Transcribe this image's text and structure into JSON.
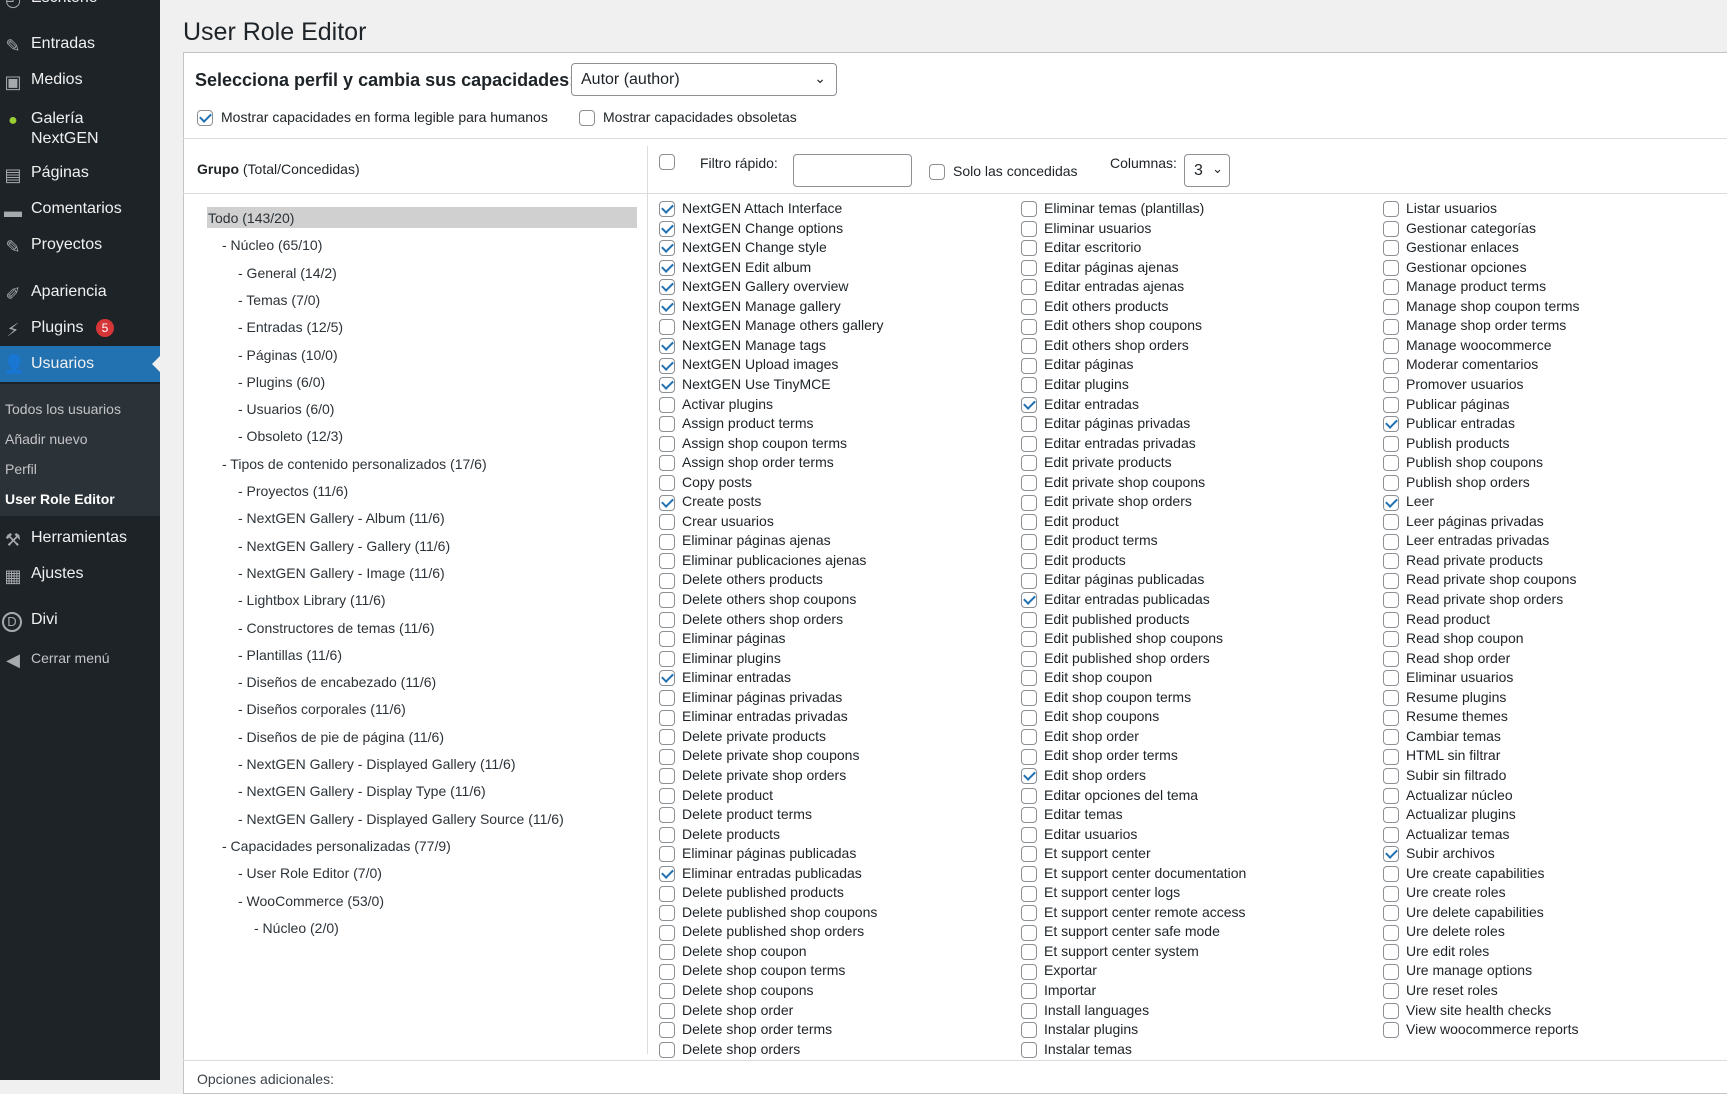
{
  "sidebar": {
    "items": [
      {
        "label": "Escritorio",
        "icon": "gauge-icon"
      },
      {
        "label": "Entradas",
        "icon": "pushpin-icon"
      },
      {
        "label": "Medios",
        "icon": "media-icon"
      },
      {
        "label": "Galería NextGEN",
        "icon": "nextgen-icon"
      },
      {
        "label": "Páginas",
        "icon": "page-icon"
      },
      {
        "label": "Comentarios",
        "icon": "comment-icon"
      },
      {
        "label": "Proyectos",
        "icon": "pushpin-icon"
      },
      {
        "label": "Apariencia",
        "icon": "brush-icon"
      },
      {
        "label": "Plugins",
        "icon": "plugin-icon",
        "badge": "5"
      },
      {
        "label": "Usuarios",
        "icon": "users-icon"
      },
      {
        "label": "Herramientas",
        "icon": "wrench-icon"
      },
      {
        "label": "Ajustes",
        "icon": "settings-icon"
      },
      {
        "label": "Divi",
        "icon": "divi-icon"
      },
      {
        "label": "Cerrar menú",
        "icon": "collapse-icon"
      }
    ],
    "users_submenu": [
      "Todos los usuarios",
      "Añadir nuevo",
      "Perfil",
      "User Role Editor"
    ],
    "accent": "#2271b1"
  },
  "page": {
    "title": "User Role Editor",
    "role_label": "Selecciona perfil y cambia sus capacidades:",
    "role_selected": "Autor (author)",
    "human_readable_label": "Mostrar capacidades en forma legible para humanos",
    "deprecated_label": "Mostrar capacidades obsoletas",
    "group_header_bold": "Grupo",
    "group_header_rest": " (Total/Concedidas)",
    "quick_filter_label": "Filtro rápido:",
    "quick_filter_value": "",
    "granted_only_label": "Solo las concedidas",
    "columns_label": "Columnas:",
    "columns_value": "3",
    "additional_options": "Opciones adicionales:"
  },
  "groups": [
    {
      "label": "Todo (143/20)",
      "level": 0
    },
    {
      "label": "- Núcleo (65/10)",
      "level": 1
    },
    {
      "label": "- General (14/2)",
      "level": 2
    },
    {
      "label": "- Temas (7/0)",
      "level": 2
    },
    {
      "label": "- Entradas (12/5)",
      "level": 2
    },
    {
      "label": "- Páginas (10/0)",
      "level": 2
    },
    {
      "label": "- Plugins (6/0)",
      "level": 2
    },
    {
      "label": "- Usuarios (6/0)",
      "level": 2
    },
    {
      "label": "- Obsoleto (12/3)",
      "level": 2
    },
    {
      "label": "- Tipos de contenido personalizados (17/6)",
      "level": 1
    },
    {
      "label": "- Proyectos (11/6)",
      "level": 2
    },
    {
      "label": "- NextGEN Gallery - Album (11/6)",
      "level": 2
    },
    {
      "label": "- NextGEN Gallery - Gallery (11/6)",
      "level": 2
    },
    {
      "label": "- NextGEN Gallery - Image (11/6)",
      "level": 2
    },
    {
      "label": "- Lightbox Library (11/6)",
      "level": 2
    },
    {
      "label": "- Constructores de temas (11/6)",
      "level": 2
    },
    {
      "label": "- Plantillas (11/6)",
      "level": 2
    },
    {
      "label": "- Diseños de encabezado (11/6)",
      "level": 2
    },
    {
      "label": "- Diseños corporales (11/6)",
      "level": 2
    },
    {
      "label": "- Diseños de pie de página (11/6)",
      "level": 2
    },
    {
      "label": "- NextGEN Gallery - Displayed Gallery (11/6)",
      "level": 2
    },
    {
      "label": "- NextGEN Gallery - Display Type (11/6)",
      "level": 2
    },
    {
      "label": "- NextGEN Gallery - Displayed Gallery Source (11/6)",
      "level": 2
    },
    {
      "label": "- Capacidades personalizadas (77/9)",
      "level": 1
    },
    {
      "label": "- User Role Editor (7/0)",
      "level": 2
    },
    {
      "label": "- WooCommerce (53/0)",
      "level": 2
    },
    {
      "label": "- Núcleo (2/0)",
      "level": 3
    }
  ],
  "capabilities": [
    [
      {
        "label": "NextGEN Attach Interface",
        "checked": true
      },
      {
        "label": "NextGEN Change options",
        "checked": true
      },
      {
        "label": "NextGEN Change style",
        "checked": true
      },
      {
        "label": "NextGEN Edit album",
        "checked": true
      },
      {
        "label": "NextGEN Gallery overview",
        "checked": true
      },
      {
        "label": "NextGEN Manage gallery",
        "checked": true
      },
      {
        "label": "NextGEN Manage others gallery",
        "checked": false
      },
      {
        "label": "NextGEN Manage tags",
        "checked": true
      },
      {
        "label": "NextGEN Upload images",
        "checked": true
      },
      {
        "label": "NextGEN Use TinyMCE",
        "checked": true
      },
      {
        "label": "Activar plugins",
        "checked": false
      },
      {
        "label": "Assign product terms",
        "checked": false
      },
      {
        "label": "Assign shop coupon terms",
        "checked": false
      },
      {
        "label": "Assign shop order terms",
        "checked": false
      },
      {
        "label": "Copy posts",
        "checked": false
      },
      {
        "label": "Create posts",
        "checked": true
      },
      {
        "label": "Crear usuarios",
        "checked": false
      },
      {
        "label": "Eliminar páginas ajenas",
        "checked": false
      },
      {
        "label": "Eliminar publicaciones ajenas",
        "checked": false
      },
      {
        "label": "Delete others products",
        "checked": false
      },
      {
        "label": "Delete others shop coupons",
        "checked": false
      },
      {
        "label": "Delete others shop orders",
        "checked": false
      },
      {
        "label": "Eliminar páginas",
        "checked": false
      },
      {
        "label": "Eliminar plugins",
        "checked": false
      },
      {
        "label": "Eliminar entradas",
        "checked": true
      },
      {
        "label": "Eliminar páginas privadas",
        "checked": false
      },
      {
        "label": "Eliminar entradas privadas",
        "checked": false
      },
      {
        "label": "Delete private products",
        "checked": false
      },
      {
        "label": "Delete private shop coupons",
        "checked": false
      },
      {
        "label": "Delete private shop orders",
        "checked": false
      },
      {
        "label": "Delete product",
        "checked": false
      },
      {
        "label": "Delete product terms",
        "checked": false
      },
      {
        "label": "Delete products",
        "checked": false
      },
      {
        "label": "Eliminar páginas publicadas",
        "checked": false
      },
      {
        "label": "Eliminar entradas publicadas",
        "checked": true
      },
      {
        "label": "Delete published products",
        "checked": false
      },
      {
        "label": "Delete published shop coupons",
        "checked": false
      },
      {
        "label": "Delete published shop orders",
        "checked": false
      },
      {
        "label": "Delete shop coupon",
        "checked": false
      },
      {
        "label": "Delete shop coupon terms",
        "checked": false
      },
      {
        "label": "Delete shop coupons",
        "checked": false
      },
      {
        "label": "Delete shop order",
        "checked": false
      },
      {
        "label": "Delete shop order terms",
        "checked": false
      },
      {
        "label": "Delete shop orders",
        "checked": false
      }
    ],
    [
      {
        "label": "Eliminar temas (plantillas)",
        "checked": false
      },
      {
        "label": "Eliminar usuarios",
        "checked": false
      },
      {
        "label": "Editar escritorio",
        "checked": false
      },
      {
        "label": "Editar páginas ajenas",
        "checked": false
      },
      {
        "label": "Editar entradas ajenas",
        "checked": false
      },
      {
        "label": "Edit others products",
        "checked": false
      },
      {
        "label": "Edit others shop coupons",
        "checked": false
      },
      {
        "label": "Edit others shop orders",
        "checked": false
      },
      {
        "label": "Editar páginas",
        "checked": false
      },
      {
        "label": "Editar plugins",
        "checked": false
      },
      {
        "label": "Editar entradas",
        "checked": true
      },
      {
        "label": "Editar páginas privadas",
        "checked": false
      },
      {
        "label": "Editar entradas privadas",
        "checked": false
      },
      {
        "label": "Edit private products",
        "checked": false
      },
      {
        "label": "Edit private shop coupons",
        "checked": false
      },
      {
        "label": "Edit private shop orders",
        "checked": false
      },
      {
        "label": "Edit product",
        "checked": false
      },
      {
        "label": "Edit product terms",
        "checked": false
      },
      {
        "label": "Edit products",
        "checked": false
      },
      {
        "label": "Editar páginas publicadas",
        "checked": false
      },
      {
        "label": "Editar entradas publicadas",
        "checked": true
      },
      {
        "label": "Edit published products",
        "checked": false
      },
      {
        "label": "Edit published shop coupons",
        "checked": false
      },
      {
        "label": "Edit published shop orders",
        "checked": false
      },
      {
        "label": "Edit shop coupon",
        "checked": false
      },
      {
        "label": "Edit shop coupon terms",
        "checked": false
      },
      {
        "label": "Edit shop coupons",
        "checked": false
      },
      {
        "label": "Edit shop order",
        "checked": false
      },
      {
        "label": "Edit shop order terms",
        "checked": false
      },
      {
        "label": "Edit shop orders",
        "checked": true
      },
      {
        "label": "Editar opciones del tema",
        "checked": false
      },
      {
        "label": "Editar temas",
        "checked": false
      },
      {
        "label": "Editar usuarios",
        "checked": false
      },
      {
        "label": "Et support center",
        "checked": false
      },
      {
        "label": "Et support center documentation",
        "checked": false
      },
      {
        "label": "Et support center logs",
        "checked": false
      },
      {
        "label": "Et support center remote access",
        "checked": false
      },
      {
        "label": "Et support center safe mode",
        "checked": false
      },
      {
        "label": "Et support center system",
        "checked": false
      },
      {
        "label": "Exportar",
        "checked": false
      },
      {
        "label": "Importar",
        "checked": false
      },
      {
        "label": "Install languages",
        "checked": false
      },
      {
        "label": "Instalar plugins",
        "checked": false
      },
      {
        "label": "Instalar temas",
        "checked": false
      }
    ],
    [
      {
        "label": "Listar usuarios",
        "checked": false
      },
      {
        "label": "Gestionar categorías",
        "checked": false
      },
      {
        "label": "Gestionar enlaces",
        "checked": false
      },
      {
        "label": "Gestionar opciones",
        "checked": false
      },
      {
        "label": "Manage product terms",
        "checked": false
      },
      {
        "label": "Manage shop coupon terms",
        "checked": false
      },
      {
        "label": "Manage shop order terms",
        "checked": false
      },
      {
        "label": "Manage woocommerce",
        "checked": false
      },
      {
        "label": "Moderar comentarios",
        "checked": false
      },
      {
        "label": "Promover usuarios",
        "checked": false
      },
      {
        "label": "Publicar páginas",
        "checked": false
      },
      {
        "label": "Publicar entradas",
        "checked": true
      },
      {
        "label": "Publish products",
        "checked": false
      },
      {
        "label": "Publish shop coupons",
        "checked": false
      },
      {
        "label": "Publish shop orders",
        "checked": false
      },
      {
        "label": "Leer",
        "checked": true
      },
      {
        "label": "Leer páginas privadas",
        "checked": false
      },
      {
        "label": "Leer entradas privadas",
        "checked": false
      },
      {
        "label": "Read private products",
        "checked": false
      },
      {
        "label": "Read private shop coupons",
        "checked": false
      },
      {
        "label": "Read private shop orders",
        "checked": false
      },
      {
        "label": "Read product",
        "checked": false
      },
      {
        "label": "Read shop coupon",
        "checked": false
      },
      {
        "label": "Read shop order",
        "checked": false
      },
      {
        "label": "Eliminar usuarios",
        "checked": false
      },
      {
        "label": "Resume plugins",
        "checked": false
      },
      {
        "label": "Resume themes",
        "checked": false
      },
      {
        "label": "Cambiar temas",
        "checked": false
      },
      {
        "label": "HTML sin filtrar",
        "checked": false
      },
      {
        "label": "Subir sin filtrado",
        "checked": false
      },
      {
        "label": "Actualizar núcleo",
        "checked": false
      },
      {
        "label": "Actualizar plugins",
        "checked": false
      },
      {
        "label": "Actualizar temas",
        "checked": false
      },
      {
        "label": "Subir archivos",
        "checked": true
      },
      {
        "label": "Ure create capabilities",
        "checked": false
      },
      {
        "label": "Ure create roles",
        "checked": false
      },
      {
        "label": "Ure delete capabilities",
        "checked": false
      },
      {
        "label": "Ure delete roles",
        "checked": false
      },
      {
        "label": "Ure edit roles",
        "checked": false
      },
      {
        "label": "Ure manage options",
        "checked": false
      },
      {
        "label": "Ure reset roles",
        "checked": false
      },
      {
        "label": "View site health checks",
        "checked": false
      },
      {
        "label": "View woocommerce reports",
        "checked": false
      }
    ]
  ]
}
